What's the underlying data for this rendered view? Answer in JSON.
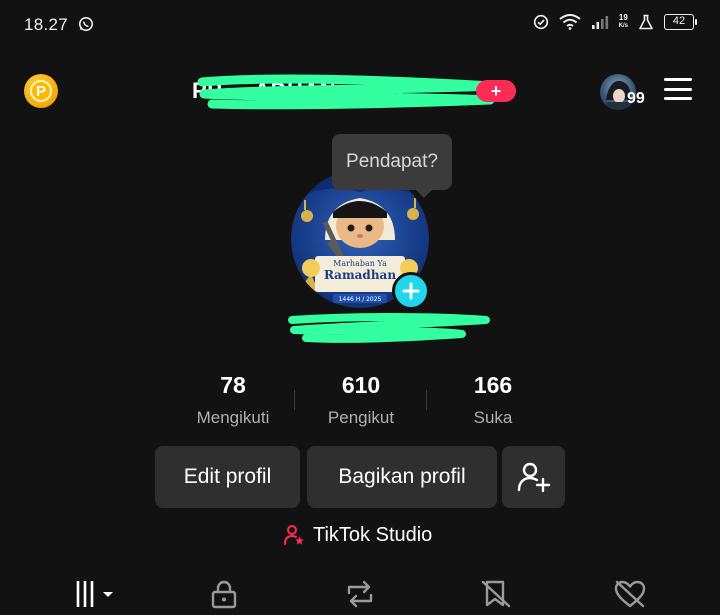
{
  "status_bar": {
    "time": "18.27",
    "net_speed_value": "19",
    "net_speed_unit": "K/s",
    "battery": "42"
  },
  "header": {
    "username": "PP ... ADHAN ... NG",
    "new_badge": "+",
    "avatar_count": "99"
  },
  "tooltip": {
    "text": "Pendapat?"
  },
  "profile_pic": {
    "banner_line1": "Marhaban Ya",
    "banner_line2": "Ramadhan",
    "banner_year": "1446 H / 2025"
  },
  "stats": [
    {
      "value": "78",
      "label": "Mengikuti"
    },
    {
      "value": "610",
      "label": "Pengikut"
    },
    {
      "value": "166",
      "label": "Suka"
    }
  ],
  "buttons": {
    "edit_profile": "Edit profil",
    "share_profile": "Bagikan profil"
  },
  "studio": {
    "label": "TikTok Studio"
  },
  "colors": {
    "background": "#121212",
    "button_bg": "#2f2f2f",
    "accent_red": "#fe2c55",
    "accent_cyan": "#20d5ec",
    "scribble_green": "#33ffa0"
  },
  "icons": {
    "tabs": [
      "videos-grid-icon",
      "lock-icon",
      "repost-icon",
      "saved-hidden-icon",
      "liked-hidden-icon"
    ]
  }
}
